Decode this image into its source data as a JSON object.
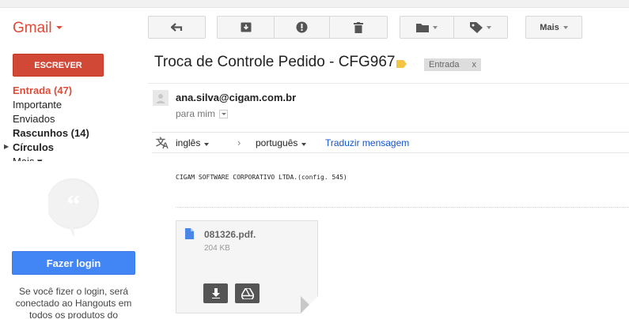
{
  "header": {
    "brand": "Gmail",
    "toolbar": {
      "more_label": "Mais"
    }
  },
  "sidebar": {
    "compose_label": "ESCREVER",
    "items": [
      {
        "label": "Entrada (47)"
      },
      {
        "label": "Importante"
      },
      {
        "label": "Enviados"
      },
      {
        "label": "Rascunhos (14)"
      },
      {
        "label": "Círculos"
      },
      {
        "label": "Mais ▾"
      }
    ],
    "hangouts": {
      "login_label": "Fazer login",
      "login_text": "Se você fizer o login, será conectado ao Hangouts em todos os produtos do"
    }
  },
  "message": {
    "subject": "Troca de Controle Pedido - CFG967",
    "label_chip": "Entrada",
    "label_remove": "x",
    "sender": "ana.silva@cigam.com.br",
    "to": "para mim",
    "body": "CIGAM SOFTWARE CORPORATIVO LTDA.(config. 545)"
  },
  "translate": {
    "from": "inglês",
    "arrow": "›",
    "to": "português",
    "link": "Traduzir mensagem"
  },
  "attachment": {
    "name": "081326.pdf.",
    "size": "204 KB"
  },
  "colors": {
    "brand_red": "#dd4b39",
    "compose_red": "#d14836",
    "login_blue": "#4285f4",
    "link_blue": "#1155cc",
    "important_tag": "#f4c542"
  }
}
